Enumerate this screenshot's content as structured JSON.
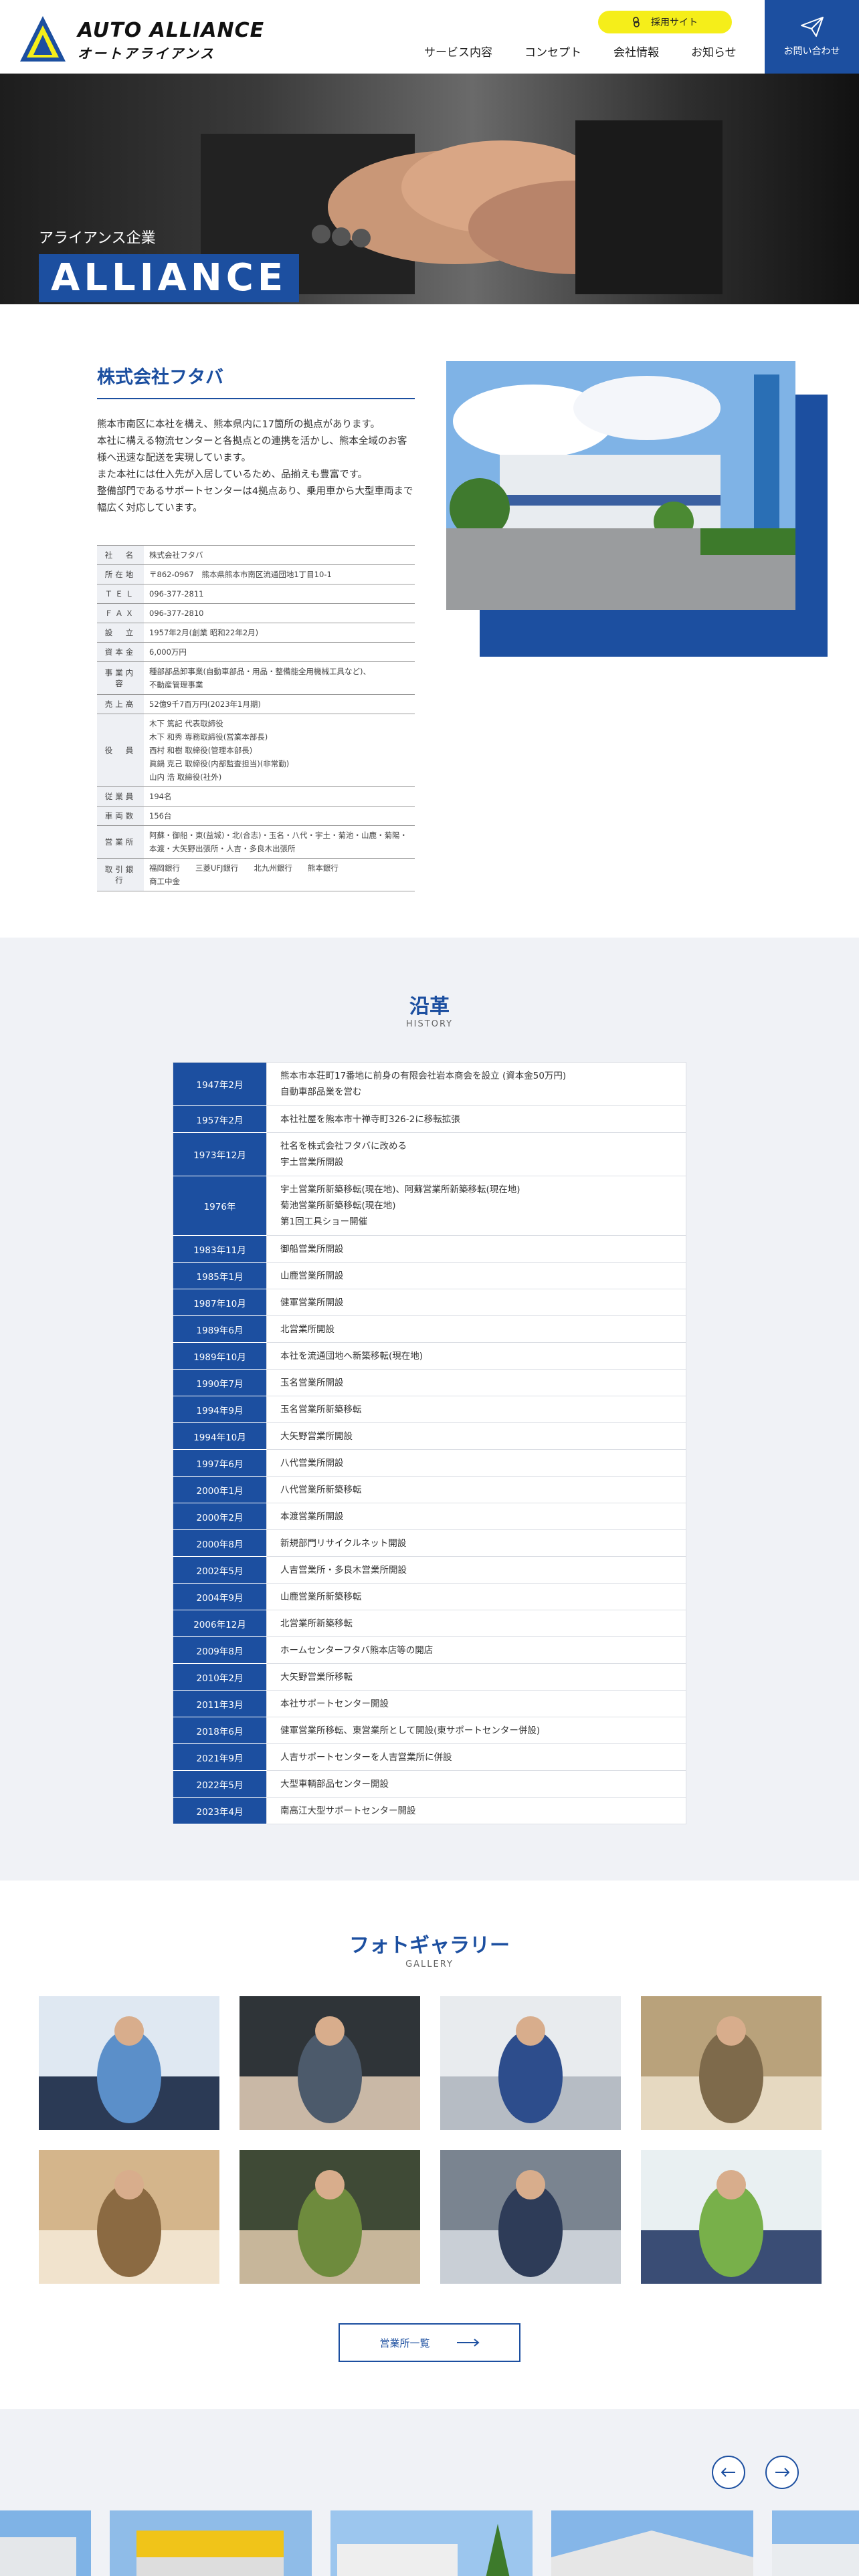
{
  "header": {
    "logo_en": "AUTO ALLIANCE",
    "logo_jp": "オートアライアンス",
    "recruit": "採用サイト",
    "nav": [
      "サービス内容",
      "コンセプト",
      "会社情報",
      "お知らせ"
    ],
    "contact": "お問い合わせ"
  },
  "hero": {
    "subtitle": "アライアンス企業",
    "title": "ALLIANCE"
  },
  "company": {
    "name": "株式会社フタバ",
    "description": [
      "熊本市南区に本社を構え、熊本県内に17箇所の拠点があります。",
      "本社に構える物流センターと各拠点との連携を活かし、熊本全域のお客様へ迅速な配送を実現しています。",
      "また本社には仕入先が入居しているため、品揃えも豊富です。",
      "整備部門であるサポートセンターは4拠点あり、乗用車から大型車両まで幅広く対応しています。"
    ],
    "rows": [
      {
        "k": "社　名",
        "v": [
          "株式会社フタバ"
        ]
      },
      {
        "k": "所在地",
        "v": [
          "〒862-0967　熊本県熊本市南区流通団地1丁目10-1"
        ]
      },
      {
        "k": "ＴＥＬ",
        "v": [
          "096-377-2811"
        ]
      },
      {
        "k": "ＦＡＸ",
        "v": [
          "096-377-2810"
        ]
      },
      {
        "k": "設　立",
        "v": [
          "1957年2月(創業 昭和22年2月)"
        ]
      },
      {
        "k": "資本金",
        "v": [
          "6,000万円"
        ]
      },
      {
        "k": "事業内容",
        "v": [
          "種部部品卸事業(自動車部品・用品・整備能全用機械工具など)、",
          "不動産管理事業"
        ]
      },
      {
        "k": "売上高",
        "v": [
          "52億9千7百万円(2023年1月期)"
        ]
      },
      {
        "k": "役　員",
        "v": [
          "木下 篤記 代表取締役",
          "木下 和秀 専務取締役(営業本部長)",
          "西村 和樹 取締役(管理本部長)",
          "眞鍋 克己 取締役(内部監査担当)(非常勤)",
          "山内 浩 取締役(社外)"
        ]
      },
      {
        "k": "従業員",
        "v": [
          "194名"
        ]
      },
      {
        "k": "車両数",
        "v": [
          "156台"
        ]
      },
      {
        "k": "営業所",
        "v": [
          "阿蘇・御船・東(益城)・北(合志)・玉名・八代・宇土・菊池・山鹿・菊陽・本渡・大矢野出張所・人吉・多良木出張所"
        ]
      },
      {
        "k": "取引銀行",
        "v": [
          "福岡銀行　　三菱UFJ銀行　　北九州銀行　　熊本銀行",
          "商工中金"
        ]
      }
    ]
  },
  "history": {
    "title": "沿革",
    "subtitle": "HISTORY",
    "rows": [
      {
        "d": "1947年2月",
        "e": [
          "熊本市本荘町17番地に前身の有限会社岩本商会を設立 (資本金50万円)",
          "自動車部品業を営む"
        ]
      },
      {
        "d": "1957年2月",
        "e": [
          "本社社屋を熊本市十禅寺町326-2に移転拡張"
        ]
      },
      {
        "d": "1973年12月",
        "e": [
          "社名を株式会社フタバに改める",
          "宇土営業所開設"
        ]
      },
      {
        "d": "1976年",
        "e": [
          "宇土営業所新築移転(現在地)、阿蘇営業所新築移転(現在地)",
          "菊池営業所新築移転(現在地)",
          "第1回工具ショー開催"
        ]
      },
      {
        "d": "1983年11月",
        "e": [
          "御船営業所開設"
        ]
      },
      {
        "d": "1985年1月",
        "e": [
          "山鹿営業所開設"
        ]
      },
      {
        "d": "1987年10月",
        "e": [
          "健軍営業所開設"
        ]
      },
      {
        "d": "1989年6月",
        "e": [
          "北営業所開設"
        ]
      },
      {
        "d": "1989年10月",
        "e": [
          "本社を流通団地へ新築移転(現在地)"
        ]
      },
      {
        "d": "1990年7月",
        "e": [
          "玉名営業所開設"
        ]
      },
      {
        "d": "1994年9月",
        "e": [
          "玉名営業所新築移転"
        ]
      },
      {
        "d": "1994年10月",
        "e": [
          "大矢野営業所開設"
        ]
      },
      {
        "d": "1997年6月",
        "e": [
          "八代営業所開設"
        ]
      },
      {
        "d": "2000年1月",
        "e": [
          "八代営業所新築移転"
        ]
      },
      {
        "d": "2000年2月",
        "e": [
          "本渡営業所開設"
        ]
      },
      {
        "d": "2000年8月",
        "e": [
          "新規部門リサイクルネット開設"
        ]
      },
      {
        "d": "2002年5月",
        "e": [
          "人吉営業所・多良木営業所開設"
        ]
      },
      {
        "d": "2004年9月",
        "e": [
          "山鹿営業所新築移転"
        ]
      },
      {
        "d": "2006年12月",
        "e": [
          "北営業所新築移転"
        ]
      },
      {
        "d": "2009年8月",
        "e": [
          "ホームセンターフタバ熊本店等の開店"
        ]
      },
      {
        "d": "2010年2月",
        "e": [
          "大矢野営業所移転"
        ]
      },
      {
        "d": "2011年3月",
        "e": [
          "本社サポートセンター開設"
        ]
      },
      {
        "d": "2018年6月",
        "e": [
          "健軍営業所移転、東営業所として開設(東サポートセンター併設)"
        ]
      },
      {
        "d": "2021年9月",
        "e": [
          "人吉サポートセンターを人吉営業所に併設"
        ]
      },
      {
        "d": "2022年5月",
        "e": [
          "大型車輌部品センター開設"
        ]
      },
      {
        "d": "2023年4月",
        "e": [
          "南高江大型サポートセンター開設"
        ]
      }
    ]
  },
  "gallery": {
    "title": "フォトギャラリー",
    "subtitle": "GALLERY",
    "button": "営業所一覧"
  },
  "colors": {
    "brand": "#1c4fa0",
    "accent": "#f5ee1a",
    "section_bg": "#f0f2f6"
  }
}
